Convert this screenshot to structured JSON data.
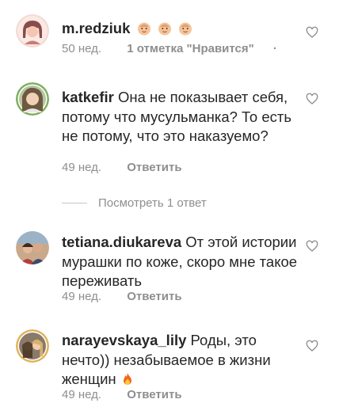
{
  "comments": [
    {
      "username": "m.redziuk",
      "text": "",
      "emoji": [
        "baby-face-emoji",
        "baby-face-emoji",
        "baby-face-emoji"
      ],
      "time": "50 нед.",
      "likes": "1 отметка \"Нравится\"",
      "more": "·"
    },
    {
      "username": "katkefir",
      "text": "Она не показывает себя, потому что мусульманка? То есть не потому, что это наказуемо?",
      "time": "49 нед.",
      "reply": "Ответить"
    },
    {
      "username": "tetiana.diukareva",
      "text": "От  этой истории мурашки по коже, скоро мне такое переживать",
      "time": "49 нед.",
      "reply": "Ответить"
    },
    {
      "username": "narayevskaya_lily",
      "text": "Роды, это нечто)) незабываемое в жизни женщин",
      "emoji": [
        "fire-emoji"
      ],
      "time": "49 нед.",
      "reply": "Ответить"
    }
  ],
  "view_replies": "Посмотреть 1 ответ",
  "colors": {
    "text": "#262626",
    "secondary": "#8e8e8e",
    "divider": "#c7c7c7"
  }
}
